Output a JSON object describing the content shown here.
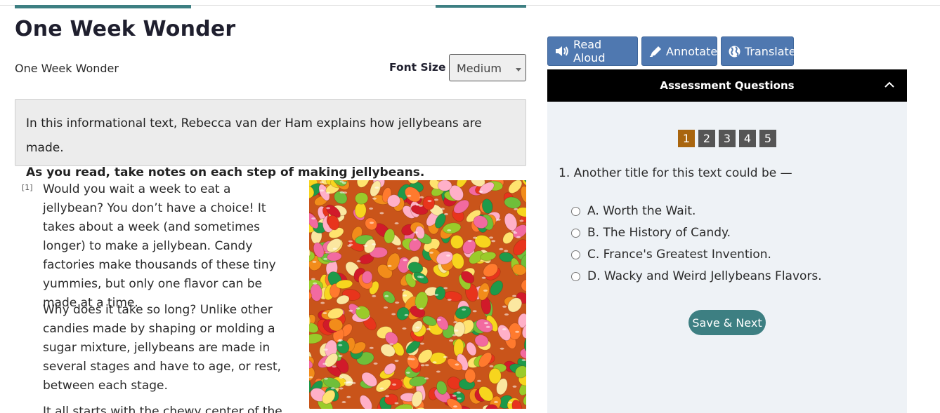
{
  "page": {
    "title": "One Week Wonder",
    "subtitle": "One Week Wonder"
  },
  "font_size": {
    "label": "Font Size",
    "selected": "Medium"
  },
  "intro": {
    "line1": "In this informational text, Rebecca van der Ham explains how jellybeans are made.",
    "line2": "As you read, take notes on each step of making jellybeans."
  },
  "article": {
    "paragraph_number": "[1]",
    "p1": "Would you wait a week to eat a jellybean? You don’t have a choice! It takes about a week (and sometimes longer) to make a jellybean. Candy factories make thousands of these tiny yummies, but only one flavor can be made at a time.",
    "p2": "Why does it take so long? Unlike other candies made by shaping or molding a sugar mixture, jellybeans are made in several stages and have to age, or rest, between each stage.",
    "p3": "It all starts with the chewy center of the"
  },
  "toolbar": {
    "read_aloud": "Read Aloud",
    "annotate": "Annotate",
    "translate": "Translate"
  },
  "assessment": {
    "header": "Assessment Questions",
    "question_numbers": [
      "1",
      "2",
      "3",
      "4",
      "5"
    ],
    "active_question": "1",
    "question": "1. Another title for this text could be —",
    "choices": [
      "A. Worth the Wait.",
      "B. The History of Candy.",
      "C. France's Greatest Invention.",
      "D. Wacky and Weird Jellybeans Flavors."
    ],
    "save_label": "Save & Next"
  },
  "colors": {
    "teal_accent": "#3d7f82",
    "tool_button": "#4f78b0",
    "active_question": "#a9650e",
    "inactive_question": "#555555"
  },
  "icons": {
    "read_aloud": "speaker-icon",
    "annotate": "pen-icon",
    "translate": "globe-icon",
    "collapse": "chevron-up-icon"
  }
}
